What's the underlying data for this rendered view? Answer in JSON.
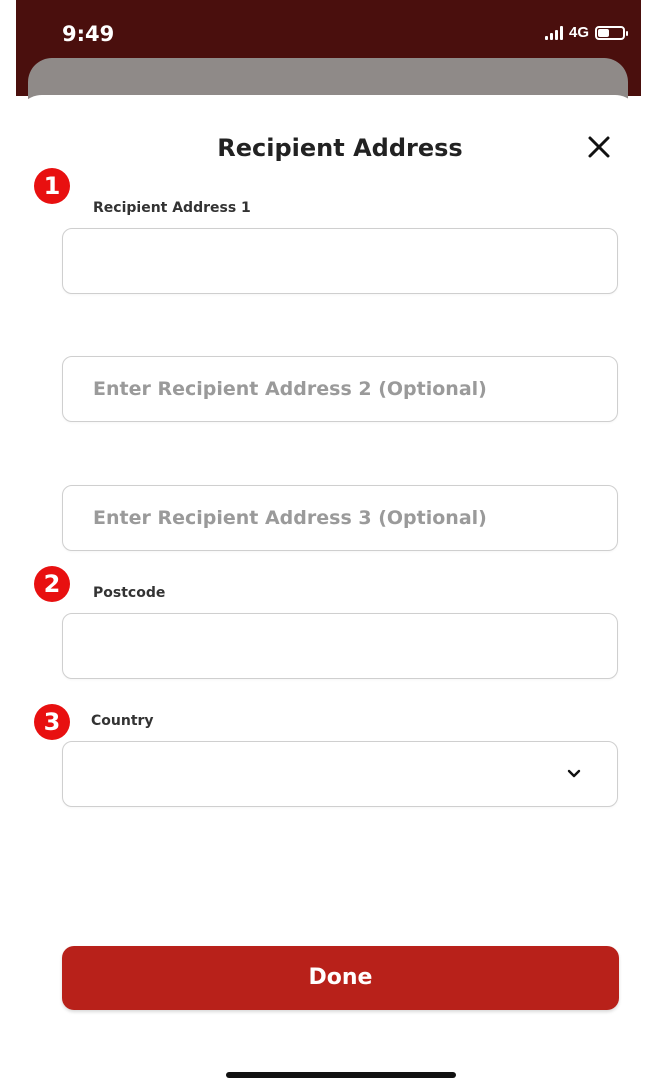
{
  "status_bar": {
    "time": "9:49",
    "network": "4G",
    "battery_level": 0.45
  },
  "sheet": {
    "title": "Recipient Address"
  },
  "markers": [
    "1",
    "2",
    "3"
  ],
  "fields": {
    "address1": {
      "label": "Recipient Address 1",
      "value": "",
      "placeholder": ""
    },
    "address2": {
      "value": "",
      "placeholder": "Enter Recipient Address 2 (Optional)"
    },
    "address3": {
      "value": "",
      "placeholder": "Enter Recipient Address 3 (Optional)"
    },
    "postcode": {
      "label": "Postcode",
      "value": "",
      "placeholder": ""
    },
    "country": {
      "label": "Country",
      "selected": ""
    }
  },
  "actions": {
    "done_label": "Done"
  },
  "colors": {
    "header_bg": "#4a0f0d",
    "accent": "#b8211a",
    "marker": "#e81010"
  },
  "icons": {
    "close": "close-icon",
    "chevron": "chevron-down-icon",
    "signal": "signal-icon",
    "battery": "battery-icon"
  }
}
